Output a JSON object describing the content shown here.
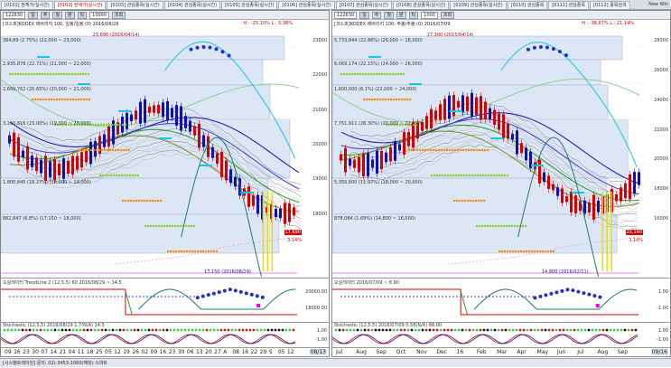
{
  "tabs": [
    "[0101] 현재가(실시간)",
    "[0102] 현재가(실시간)",
    "[0103] 관심종목(실시간)",
    "[0104] 관심종목(실시간)",
    "[0105] 관심종목(실시간)",
    "[0106] 관심종목(실시간)",
    "[0107] 관심종목(실시간)",
    "[0108] 관심종목(실시간)",
    "[0109] 관심종목(실시간)",
    "[0110] 관심종목",
    "[0111] 관심종목",
    "[0112] 종목검색"
  ],
  "new_win_label": "New Win",
  "left": {
    "code": "122630",
    "count": "10000",
    "period_btns": [
      "일",
      "주",
      "월",
      "분",
      "틱"
    ],
    "apply_btn": "조회",
    "header_text": "[코스피]KODEX 레버리지 100, 일봉/일봉 (0) 2016/08/26",
    "stat_text": "H : -25.10%  L : 5.38%",
    "high_label": "23,690 (2016/04/14)",
    "low_label": "17,150 (2016/08/29)",
    "price_box_labels": [
      "384,89 (2.75%) (22,000 ~ 23,000)",
      "2,935,878 (22.71%) (21,000 ~ 22,000)",
      "2,669,762 (20.65%) (20,000 ~ 21,000)",
      "3,160,816 (23.00%) (19,000 ~ 20,000)",
      "1,800,845 (18.27%) (18,000 ~ 19,000)",
      "882,847 (6.8%) (17,150 ~ 18,000)"
    ],
    "y_labels": [
      "23000",
      "22000",
      "21000",
      "20000",
      "19000",
      "18000"
    ],
    "last_price": "17,690",
    "last_change": "3.14%",
    "ind1_title": "오실레이터 TrendLine 2 (12,5,5) 60 2016/08/29 ~ 14.5",
    "ind1_y": [
      "20000.00",
      "18000.00"
    ],
    "ind2_title": "Stochastic (12,5,5) 2016/08/29 1.7(N/A) 14.5",
    "ind2_y": [
      "1.00",
      "-1.00"
    ],
    "x_labels": [
      "09",
      "16",
      "23",
      "30",
      "07",
      "14",
      "21",
      "04",
      "11",
      "18",
      "25",
      "05",
      "12",
      "19",
      "26",
      "02",
      "09",
      "16",
      "23",
      "30",
      "06",
      "13",
      "20",
      "27",
      "A",
      "08",
      "16",
      "22",
      "29",
      "S",
      "05",
      "12"
    ],
    "date_badge": "08/13"
  },
  "right": {
    "code": "122630",
    "count": "1000",
    "period_btns": [
      "일",
      "주",
      "월",
      "분",
      "틱"
    ],
    "apply_btn": "조회",
    "header_text": "[코스피]KODEX 레버리지 100, 주봉/주봉 (0) 2016/07/09",
    "stat_text": "H : -36.67%  L : 21.14%",
    "high_label": "27,300 (2015/04/14)",
    "low_label": "14,800 (2016/02/11)",
    "price_box_labels": [
      "5,733,844 (22.86%) (26,000 ~ 28,000)",
      "6,069,174 (22.15%) (24,000 ~ 26,000)",
      "1,600,000 (6.1%) (22,000 ~ 24,000)",
      "7,751,911 (28.30%) (20,000 ~ 22,000)",
      "5,350,600 (11.97%) (18,000 ~ 20,000)",
      "878,084 (1.69%) (14,800 ~ 16,000)"
    ],
    "y_labels": [
      "28000",
      "26000",
      "24000",
      "22000",
      "20000",
      "18000",
      "16000"
    ],
    "last_price": "20,140",
    "last_change": "3.14%",
    "ind1_title": "오실레이터 2016/07/09 ~ 8.90",
    "ind1_y": [
      "1.00",
      "-1.00"
    ],
    "ind2_title": "Stochastic (12,5,5) 2016/07/09 0.58(N/A) 68.00",
    "ind2_y": [
      "1.00",
      "-1.00"
    ],
    "x_labels": [
      "Jul",
      "Aug",
      "Sep",
      "Oct",
      "Nov",
      "Dec",
      "16",
      "Feb",
      "Mar",
      "Apr",
      "May",
      "Jun",
      "Jul",
      "Aug",
      "Sep"
    ],
    "date_badge": "09/16"
  },
  "status_text": "[시스템트레이딩] 문의: 02)-3453-1060(해외) 스마트",
  "colors": {
    "up": "#d40000",
    "down": "#1010b0",
    "bbox": "#dde6f5",
    "green": "#2a9d2a",
    "cyan": "#19c5e8",
    "teal": "#1a7e6e",
    "orange": "#ff8a00",
    "magenta": "#ee00ee"
  }
}
